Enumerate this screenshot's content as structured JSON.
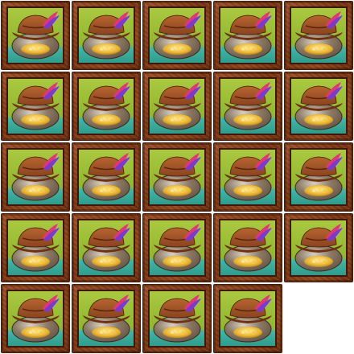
{
  "symbol": {
    "name": "pirate-hat-gold-pot-symbol",
    "tile_count": 24,
    "colors": {
      "frame": "#7a3514",
      "sky": "#86ad2c",
      "water": "#2f9b8e",
      "hat": "#8b4320",
      "feather_pink": "#e0377a",
      "feather_purple": "#7a3cc8",
      "pot": "#5a4a3a",
      "gold": "#e8b431"
    }
  }
}
